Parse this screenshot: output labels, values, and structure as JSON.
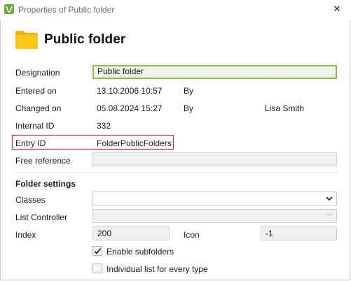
{
  "window": {
    "title": "Properties of Public folder",
    "close_glyph": "✕"
  },
  "header": {
    "icon": "folder-icon",
    "title": "Public folder",
    "folder_color": "#f5b400"
  },
  "fields": {
    "designation": {
      "label": "Designation",
      "value": "Public folder"
    },
    "entered_on": {
      "label": "Entered on",
      "value": "13.10.2006 10:57",
      "by_label": "By",
      "by_value": ""
    },
    "changed_on": {
      "label": "Changed on",
      "value": "05.08.2024 15:27",
      "by_label": "By",
      "by_value": "Lisa Smith"
    },
    "internal_id": {
      "label": "Internal ID",
      "value": "332"
    },
    "entry_id": {
      "label": "Entry ID",
      "value": "FolderPublicFolders"
    },
    "free_reference": {
      "label": "Free reference",
      "value": ""
    }
  },
  "folder_settings": {
    "title": "Folder settings",
    "classes": {
      "label": "Classes",
      "value": ""
    },
    "list_controller": {
      "label": "List Controller",
      "value": "",
      "button_glyph": "···"
    },
    "index": {
      "label": "Index",
      "value": "200"
    },
    "icon": {
      "label": "Icon",
      "value": "-1"
    },
    "enable_subfolders": {
      "label": "Enable subfolders",
      "checked": true
    },
    "individual_list": {
      "label": "Individual list for every type",
      "checked": false
    }
  },
  "colors": {
    "accent_green": "#8fbb3a",
    "highlight_red": "#d32f2f",
    "field_bg": "#f0f0f0"
  }
}
